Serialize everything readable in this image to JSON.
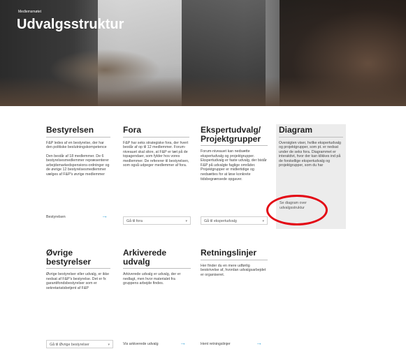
{
  "hero": {
    "breadcrumb": "Medlemsmøtet",
    "title": "Udvalgsstruktur"
  },
  "cards": {
    "bestyrelsen": {
      "title": "Bestyrelsen",
      "p1": "F&P ledes af en bestyrelse, der har den politiske beslutningskompetence",
      "p2": "Den består af 18 medlemmer. De 6 bestyrelsesmedlemmer repræsenterer arbejdsmarkedspensions-ordninger og de øvrige 12 bestyrelsesmedlemmer vælges af F&P's øvrige medlemmer",
      "link": "Bestyrelsen"
    },
    "fora": {
      "title": "Fora",
      "p1": "F&P har seks strategiske fora, der hvert består af op til 12 medlemmer. Forum-niveauet skal sikre, at F&P er tæt på de topagendaer, som fylder hos vores medlemmer. De refererer til bestyrelsen, som også udpeger medlemmer af fora.",
      "select": "Gå til fora"
    },
    "ekspert": {
      "title_l1": "Ekspertudvalg/",
      "title_l2": "Projektgrupper",
      "p1": "Forum-niveauet kan nedsætte ekspertudvalg og projektgrupper. Ekspertudvalg er faste udvalg, der bistår F&P på udvalgte faglige områder. Projektgrupper er midlertidige og nedsættes for at løse konkrete tidsbegrænsede opgaver.",
      "select": "Gå til ekspertudvalg"
    },
    "diagram": {
      "title": "Diagram",
      "p1": "Oversigten viser, hvilke ekspertudvalg og projektgrupper, som pt. er nedsat under de seks fora. Diagrammet er interaktivt, hvor der kan klikkes ind på de forskellige ekspertudvalg og projektgrupper, som du har",
      "link_l1": "Se diagram over",
      "link_l2": "udvalgsstruktur"
    },
    "ovrige": {
      "title_l1": "Øvrige",
      "title_l2": "bestyrelser",
      "p1": "Øvrige bestyrelser eller udvalg, er ikke nedsat af F&P's bestyrelse. Det er fx garantifondsbestyrelser som er sekretariatsbetjent af F&P",
      "select": "Gå til Øvrige bestyrelser"
    },
    "arkiverede": {
      "title_l1": "Arkiverede",
      "title_l2": "udvalg",
      "p1": "Arkiverede udvalg er udvalg, der er nedlagt, men hvor materialet fra gruppens arbejde findes.",
      "link": "Vis arkiverede udvalg"
    },
    "retning": {
      "title": "Retningslinjer",
      "p1": "Her finder du en mere udførlig beskrivelse af, hvordan udvalgsarbejdet er organiseret.",
      "link": "Hent retningslinjer"
    }
  },
  "icons": {
    "arrow": "→",
    "chevron": "▾"
  },
  "colors": {
    "accent": "#2a9fd6",
    "highlight": "#e30613"
  }
}
